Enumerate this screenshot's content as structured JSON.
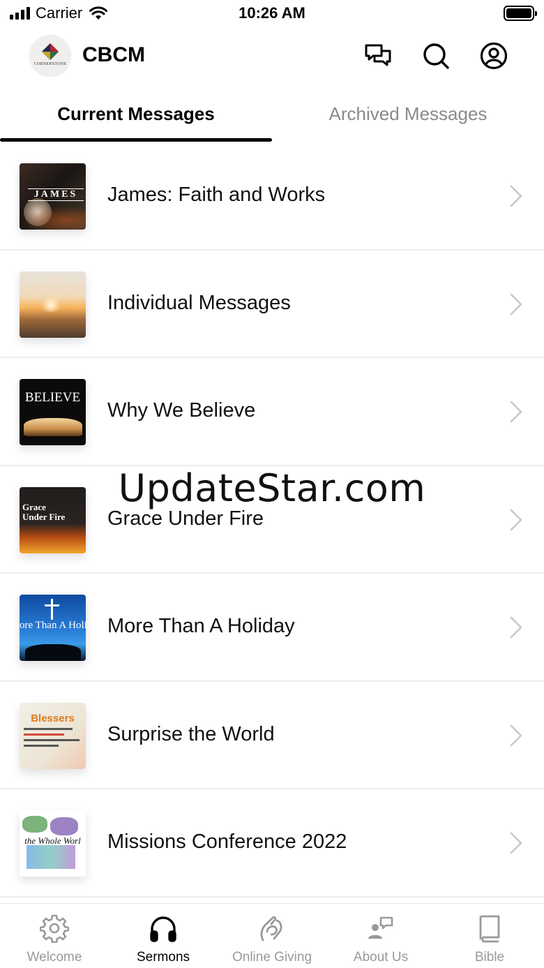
{
  "status_bar": {
    "carrier": "Carrier",
    "time": "10:26 AM"
  },
  "header": {
    "title": "CBCM",
    "logo_text": "CORNERSTONE",
    "icons": [
      "chat-icon",
      "search-icon",
      "profile-icon"
    ]
  },
  "tabs": {
    "current": "Current Messages",
    "archived": "Archived Messages",
    "active_index": 0
  },
  "messages": [
    {
      "title": "James: Faith and Works",
      "thumb_text": "JAMES"
    },
    {
      "title": "Individual Messages",
      "thumb_text": ""
    },
    {
      "title": "Why We Believe",
      "thumb_text": "BELIEVE"
    },
    {
      "title": "Grace Under Fire",
      "thumb_text": "Grace Under Fire"
    },
    {
      "title": "More Than A Holiday",
      "thumb_text": "ore Than A Holid"
    },
    {
      "title": "Surprise the World",
      "thumb_text": "Blessers"
    },
    {
      "title": "Missions Conference 2022",
      "thumb_text": "the Whole Worl"
    }
  ],
  "watermark": "UpdateStar.com",
  "tabbar": {
    "items": [
      {
        "label": "Welcome",
        "icon": "gear-icon"
      },
      {
        "label": "Sermons",
        "icon": "headphones-icon"
      },
      {
        "label": "Online Giving",
        "icon": "giving-icon"
      },
      {
        "label": "About Us",
        "icon": "people-icon"
      },
      {
        "label": "Bible",
        "icon": "book-icon"
      }
    ],
    "active_index": 1
  },
  "colors": {
    "active": "#000000",
    "inactive": "#999999",
    "divider": "#ececec"
  }
}
